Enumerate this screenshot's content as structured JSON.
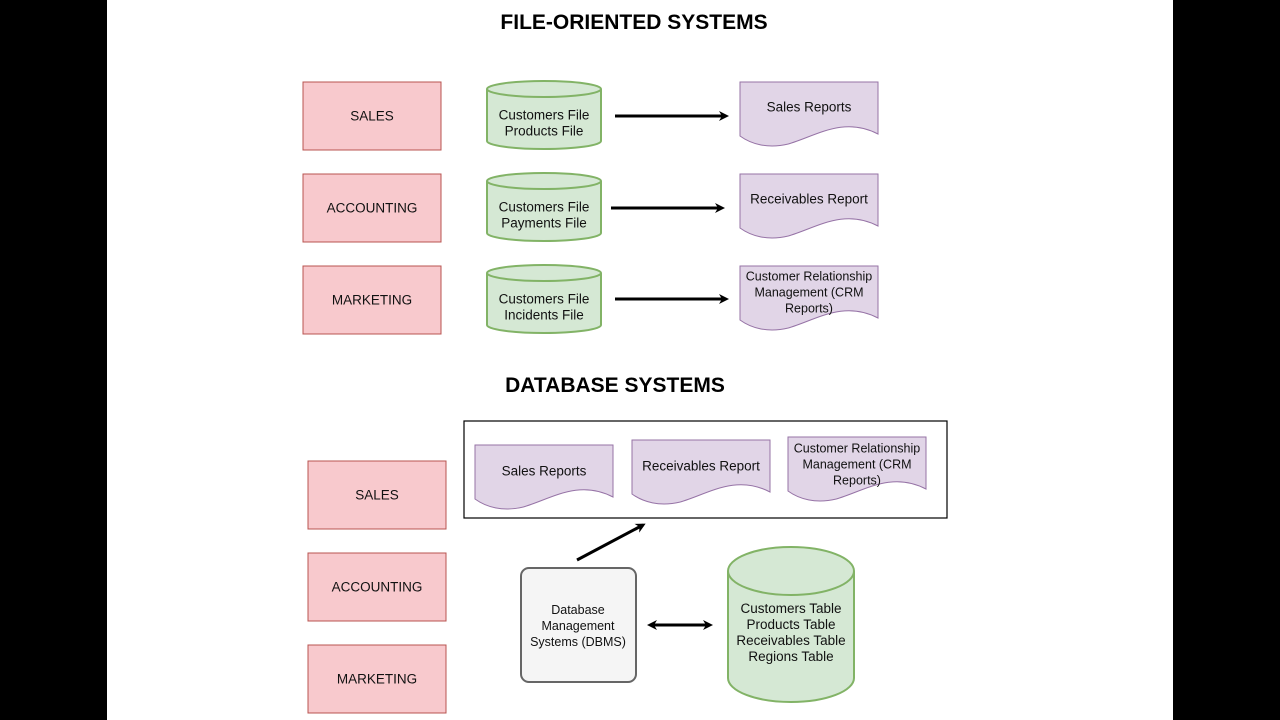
{
  "file_oriented": {
    "title": "FILE-ORIENTED SYSTEMS",
    "rows": [
      {
        "department": "SALES",
        "files": [
          "Customers File",
          "Products File"
        ],
        "report": [
          "Sales Reports"
        ]
      },
      {
        "department": "ACCOUNTING",
        "files": [
          "Customers File",
          "Payments File"
        ],
        "report": [
          "Receivables Report"
        ]
      },
      {
        "department": "MARKETING",
        "files": [
          "Customers File",
          "Incidents File"
        ],
        "report": [
          "Customer Relationship",
          "Management (CRM",
          "Reports)"
        ]
      }
    ]
  },
  "database": {
    "title": "DATABASE SYSTEMS",
    "departments": [
      "SALES",
      "ACCOUNTING",
      "MARKETING"
    ],
    "reports": [
      [
        "Sales Reports"
      ],
      [
        "Receivables Report"
      ],
      [
        "Customer Relationship",
        "Management (CRM",
        "Reports)"
      ]
    ],
    "dbms": [
      "Database",
      "Management",
      "Systems (DBMS)"
    ],
    "tables": [
      "Customers Table",
      "Products Table",
      "Receivables Table",
      "Regions Table"
    ]
  },
  "colors": {
    "department_fill": "#f8c9cd",
    "department_stroke": "#b85450",
    "file_fill": "#d5e8d4",
    "file_stroke": "#82b366",
    "report_fill": "#e1d5e7",
    "report_stroke": "#9673a6",
    "dbms_fill": "#f5f5f5",
    "dbms_stroke": "#666666"
  }
}
